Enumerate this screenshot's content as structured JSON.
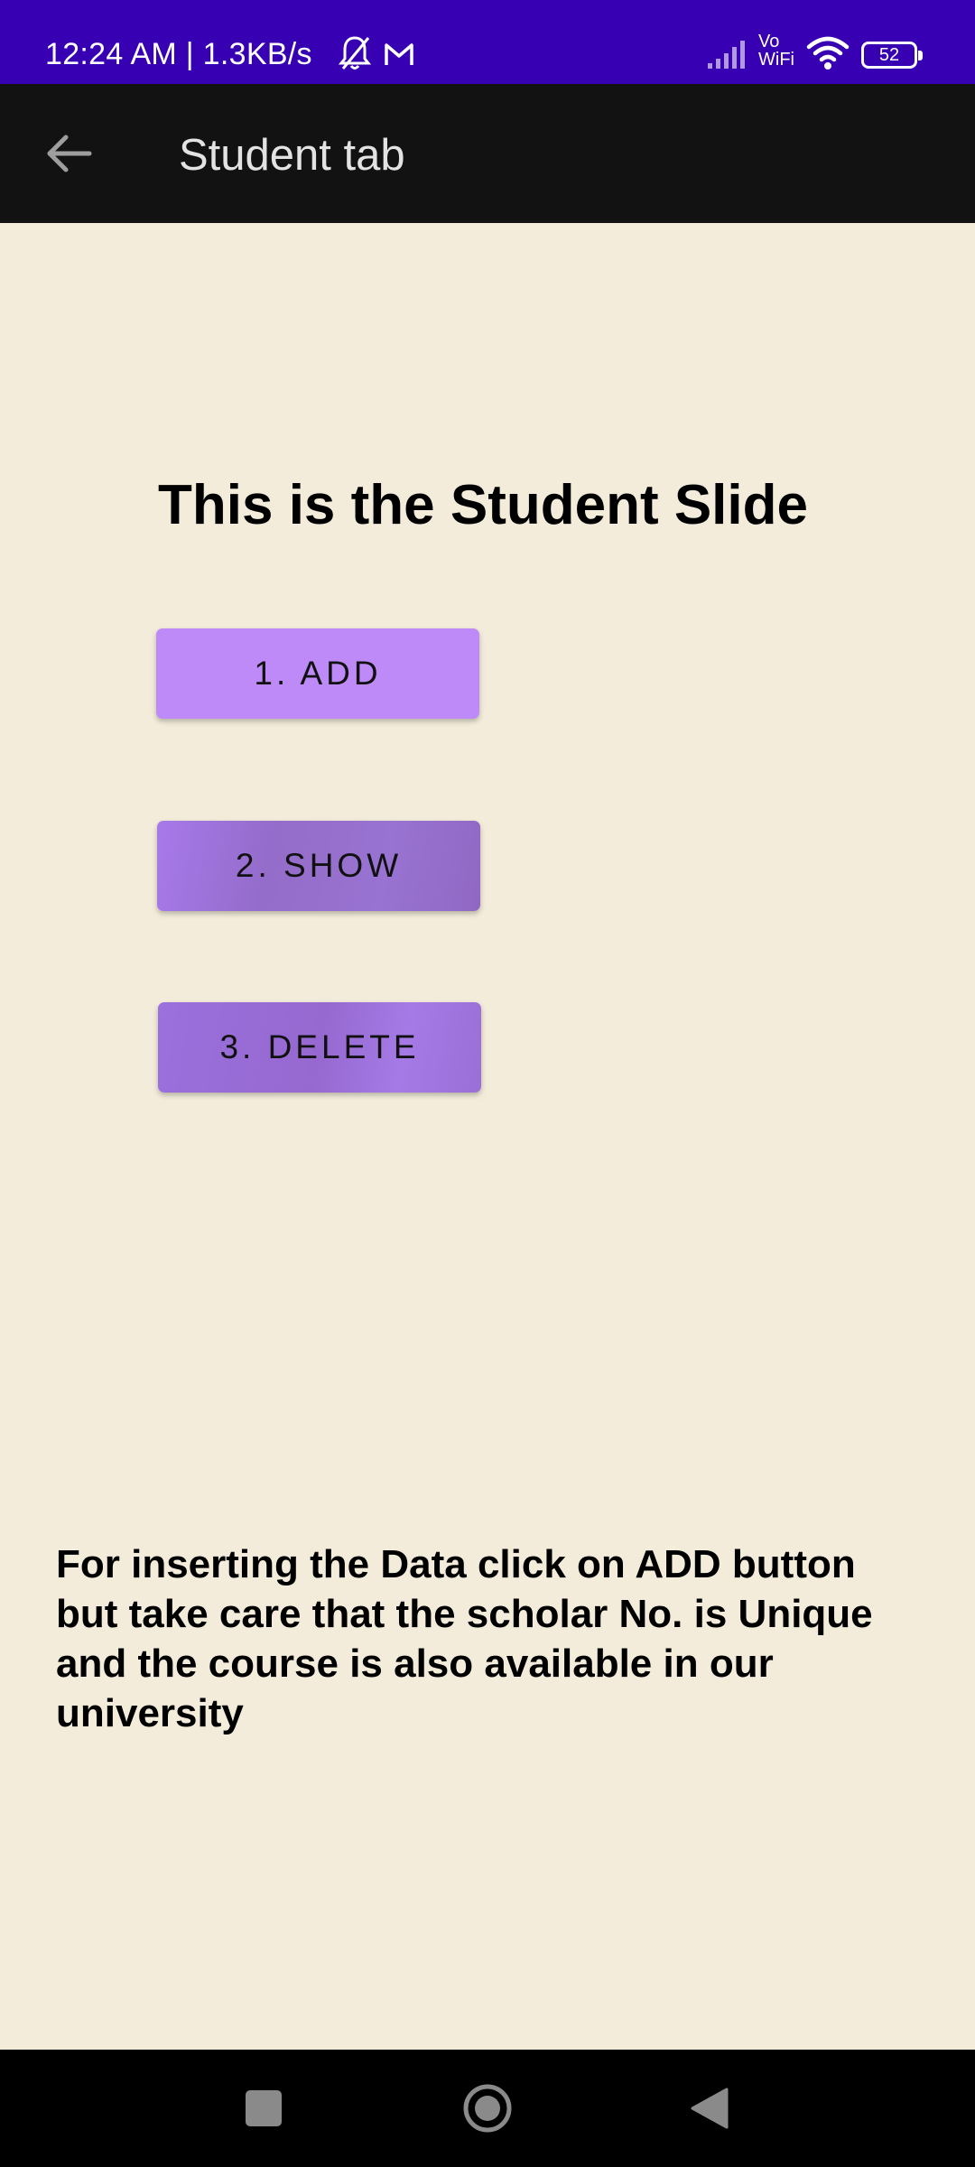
{
  "status_bar": {
    "time_and_speed": "12:24 AM | 1.3KB/s",
    "network_label": "Vo\nWiFi",
    "battery": "52"
  },
  "app_bar": {
    "title": "Student tab",
    "back_icon": "arrow-back-icon"
  },
  "main": {
    "heading": "This is the Student Slide",
    "buttons": [
      {
        "label": "1. ADD"
      },
      {
        "label": "2. SHOW"
      },
      {
        "label": "3. DELETE"
      }
    ],
    "info_text": "For inserting the Data click on ADD button but take care that the scholar No. is Unique and the course is also available in our university"
  },
  "colors": {
    "status_bar": "#3700b3",
    "app_bar": "#121212",
    "background": "#f3ecda",
    "button_add": "#bd8af7",
    "button_show": "#946cca",
    "button_delete": "#9569cf"
  },
  "nav_bar": {
    "icons": [
      "recents-square-icon",
      "home-circle-icon",
      "back-triangle-icon"
    ]
  }
}
